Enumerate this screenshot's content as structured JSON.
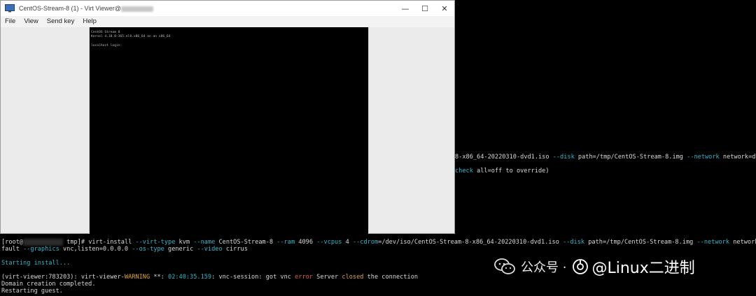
{
  "window": {
    "title_prefix": "CentOS-Stream-8 (1) - Virt Viewer@",
    "minimize_glyph": "—",
    "maximize_glyph": "☐",
    "close_glyph": "✕",
    "menu": [
      "File",
      "View",
      "Send key",
      "Help"
    ]
  },
  "vm_console": {
    "lines": [
      "CentOS Stream 8",
      "Kernel 4.18.0-365.el8.x86_64 on an x86_64",
      "",
      "localhost login:"
    ]
  },
  "terminal": {
    "partial1": {
      "a": "8-x86_64-20220310-dvd1.iso ",
      "opt1": "--disk",
      "b": " path=/tmp/CentOS-Stream-8.img ",
      "opt2": "--network",
      "c": " network=de"
    },
    "partial2": {
      "a": "check",
      "b": " all=off to override)"
    },
    "cmd1": {
      "prompt_start": "[root@",
      "prompt_end": " tmp]# ",
      "cmd": "virt-install ",
      "o_virt": "--virt-type",
      "v_virt": " kvm ",
      "o_name": "--name",
      "v_name": " CentOS-Stream-8 ",
      "o_ram": "--ram",
      "v_ram": " 4096 ",
      "o_vcpus": "--vcpus",
      "v_vcpus": " 4 ",
      "o_cdrom": "--cdrom",
      "v_cdrom": "=/dev/iso/CentOS-Stream-8-x86_64-20220310-dvd1.iso ",
      "o_disk": "--disk",
      "v_disk": " path=/tmp/CentOS-Stream-8.img ",
      "o_net": "--network",
      "v_net": " network=de"
    },
    "cmd2": {
      "a": "fault ",
      "o_graphics": "--graphics",
      "v_graphics": " vnc,listen=0.0.0.0 ",
      "o_os": "--os-type",
      "v_os": " generic ",
      "o_video": "--video",
      "v_video": " cirrus"
    },
    "starting": "Starting install...",
    "warn": {
      "a": "(virt-viewer:783203): virt-viewer-",
      "warning": "WARNING",
      "b": " **: ",
      "time": "02:40:35.159",
      "c": ": vnc-session: got vnc ",
      "error": "error",
      "d": " Server ",
      "closed": "closed",
      "e": " the connection"
    },
    "domain": "Domain creation completed.",
    "restart": "Restarting guest."
  },
  "watermark": {
    "text1": "公众号 · ",
    "text2a": "@Linux",
    "text2b": "二进制"
  },
  "colors": {
    "option": "#2fb7c9",
    "warning": "#e2a33a",
    "error": "#e05a4e"
  }
}
